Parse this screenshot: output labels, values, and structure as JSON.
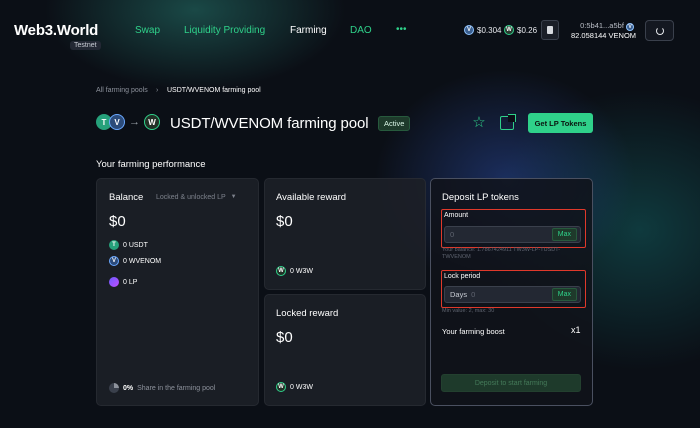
{
  "header": {
    "logo": "Web3.World",
    "badge": "Testnet",
    "nav": [
      "Swap",
      "Liquidity Providing",
      "Farming",
      "DAO",
      "•••"
    ],
    "prices": [
      {
        "icon": "V",
        "text": "$0.304"
      },
      {
        "icon": "W",
        "text": "$0.26"
      }
    ],
    "wallet_address": "0:5b41...a5bf",
    "wallet_balance": "82.058144 VENOM"
  },
  "breadcrumb": {
    "parent": "All farming pools",
    "separator": "›",
    "current": "USDT/WVENOM farming pool"
  },
  "pool": {
    "title": "USDT/WVENOM farming pool",
    "status": "Active",
    "get_lp_label": "Get LP Tokens",
    "token_a": "T",
    "token_b": "V",
    "token_out": "W",
    "arrow": "→"
  },
  "performance": {
    "heading": "Your farming performance",
    "balance": {
      "label": "Balance",
      "filter": "Locked & unlocked LP",
      "value": "$0",
      "rows": [
        {
          "icon": "T",
          "text": "0 USDT"
        },
        {
          "icon": "V",
          "text": "0 WVENOM"
        },
        {
          "icon": "",
          "text": "0 LP"
        }
      ],
      "share_value": "0%",
      "share_text": "Share in the farming pool"
    },
    "available": {
      "label": "Available reward",
      "value": "$0",
      "token": "W",
      "amount": "0 W3W"
    },
    "locked": {
      "label": "Locked reward",
      "value": "$0",
      "token": "W",
      "amount": "0 W3W"
    }
  },
  "deposit": {
    "title": "Deposit LP tokens",
    "amount_label": "Amount",
    "amount_placeholder": "0",
    "max_label": "Max",
    "balance_hint": "Your balance: 1.7867424911 TW3W-LP-TUSDT-TWVENOM",
    "lock_label": "Lock period",
    "days_prefix": "Days",
    "days_placeholder": "0",
    "lock_hint": "Min value: 2, max: 30",
    "boost_label": "Your farming boost",
    "boost_value": "x1",
    "submit_label": "Deposit to start farming"
  },
  "colors": {
    "accent": "#2fd18a",
    "background": "#0b0f16",
    "highlight_border": "#e0392b"
  }
}
